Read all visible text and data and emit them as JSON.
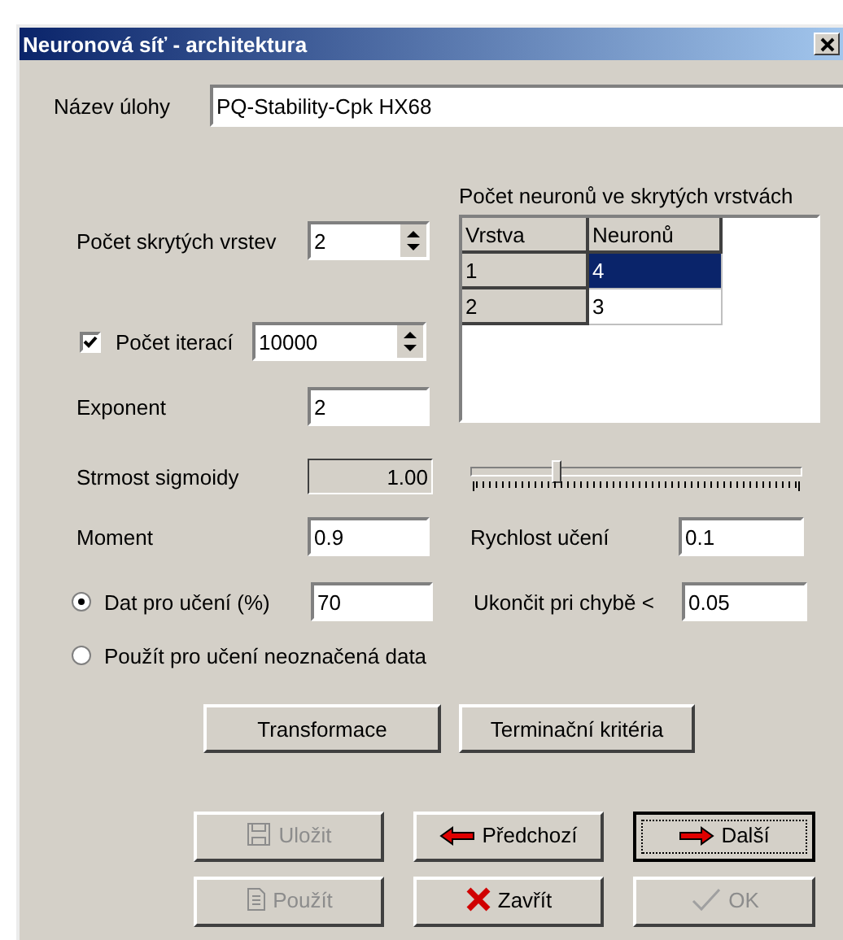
{
  "window": {
    "title": "Neuronová síť - architektura"
  },
  "task_name": {
    "label": "Název úlohy",
    "value": "PQ-Stability-Cpk HX68"
  },
  "hidden_layers": {
    "label": "Počet skrytých vrstev",
    "value": "2"
  },
  "iterations": {
    "label": "Počet iterací",
    "value": "10000",
    "checked": true
  },
  "exponent": {
    "label": "Exponent",
    "value": "2"
  },
  "neurons_table": {
    "title": "Počet neuronů ve skrytých vrstvách",
    "columns": [
      "Vrstva",
      "Neuronů"
    ],
    "rows": [
      {
        "cells": [
          "1",
          "4"
        ],
        "selected": true
      },
      {
        "cells": [
          "2",
          "3"
        ],
        "selected": false
      }
    ]
  },
  "sigmoid": {
    "label": "Strmost sigmoidy",
    "value": "1.00",
    "level": 0.25
  },
  "momentum": {
    "label": "Moment",
    "value": "0.9"
  },
  "learning_rate": {
    "label": "Rychlost učení",
    "value": "0.1"
  },
  "training_data": {
    "label": "Dat pro učení (%)",
    "value": "70",
    "selected": true
  },
  "error_stop": {
    "label": "Ukončit pri chybě <",
    "value": "0.05"
  },
  "unlabeled_data": {
    "label": "Použít pro učení neoznačená data",
    "selected": false
  },
  "action_buttons": [
    {
      "label": "Transformace"
    },
    {
      "label": "Terminační kritéria"
    }
  ],
  "nav_buttons": [
    {
      "label": "Uložit",
      "kind": "save",
      "disabled": true,
      "focused": false
    },
    {
      "label": "Předchozí",
      "kind": "back",
      "disabled": false,
      "focused": false
    },
    {
      "label": "Další",
      "kind": "next",
      "disabled": false,
      "focused": true
    },
    {
      "label": "Použít",
      "kind": "apply",
      "disabled": true,
      "focused": false
    },
    {
      "label": "Zavřít",
      "kind": "close",
      "disabled": false,
      "focused": false
    },
    {
      "label": "OK",
      "kind": "ok",
      "disabled": true,
      "focused": false
    }
  ]
}
